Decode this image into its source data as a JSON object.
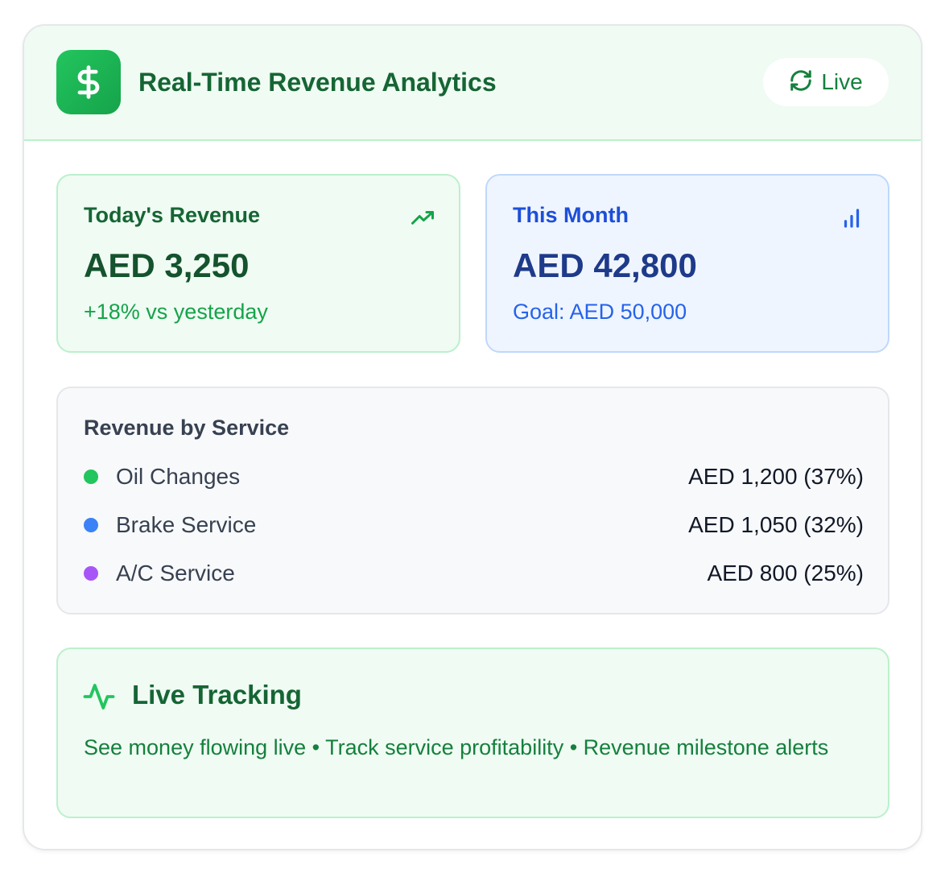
{
  "header": {
    "title": "Real-Time Revenue Analytics",
    "logo_icon": "dollar-sign-icon",
    "live_label": "Live",
    "live_icon": "refresh-icon"
  },
  "today": {
    "label": "Today's Revenue",
    "value": "AED 3,250",
    "sub": "+18% vs yesterday",
    "icon": "trending-up-icon"
  },
  "month": {
    "label": "This Month",
    "value": "AED 42,800",
    "sub": "Goal: AED 50,000",
    "icon": "bar-chart-icon"
  },
  "services": {
    "title": "Revenue by Service",
    "items": [
      {
        "name": "Oil Changes",
        "amount": "AED 1,200 (37%)",
        "color": "#22c55e"
      },
      {
        "name": "Brake Service",
        "amount": "AED 1,050 (32%)",
        "color": "#3b82f6"
      },
      {
        "name": "A/C Service",
        "amount": "AED 800 (25%)",
        "color": "#a855f7"
      }
    ]
  },
  "tracking": {
    "title": "Live Tracking",
    "icon": "activity-icon",
    "description": "See money flowing live • Track service profitability • Revenue milestone alerts"
  },
  "colors": {
    "brand_green": "#16a34a",
    "accent_blue": "#1d4ed8"
  }
}
